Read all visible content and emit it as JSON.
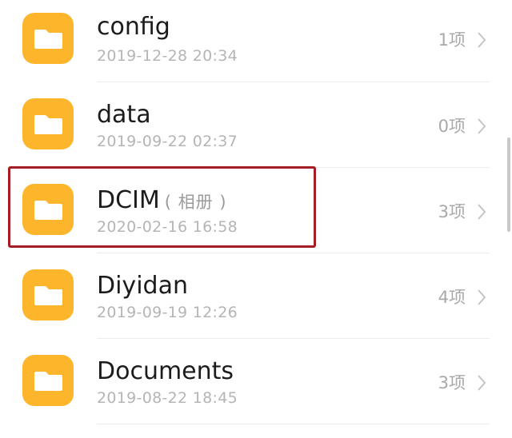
{
  "accent_color": "#FDB52B",
  "highlight_color": "#A51D24",
  "items": [
    {
      "name": "config",
      "suffix": "",
      "date": "2019-12-28 20:34",
      "count": "1项",
      "icon": "folder-icon"
    },
    {
      "name": "data",
      "suffix": "",
      "date": "2019-09-22 02:37",
      "count": "0项",
      "icon": "folder-icon"
    },
    {
      "name": "DCIM",
      "suffix": "( 相册 )",
      "date": "2020-02-16 16:58",
      "count": "3项",
      "icon": "folder-icon"
    },
    {
      "name": "Diyidan",
      "suffix": "",
      "date": "2019-09-19 12:26",
      "count": "4项",
      "icon": "folder-icon"
    },
    {
      "name": "Documents",
      "suffix": "",
      "date": "2019-08-22 18:45",
      "count": "3项",
      "icon": "folder-icon"
    }
  ]
}
